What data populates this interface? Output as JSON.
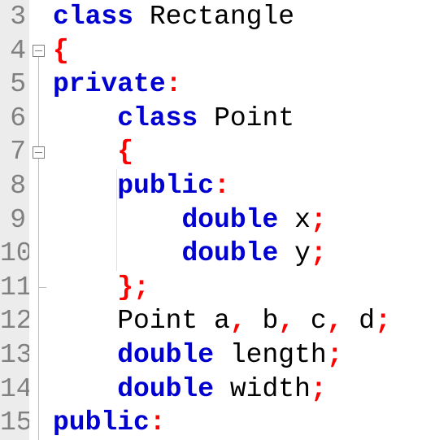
{
  "line_numbers": [
    "3",
    "4",
    "5",
    "6",
    "7",
    "8",
    "9",
    "10",
    "11",
    "12",
    "13",
    "14",
    "15"
  ],
  "code": {
    "l0": {
      "kw": "class",
      "sp": " ",
      "name": "Rectangle"
    },
    "l1": {
      "brace": "{"
    },
    "l2": {
      "access": "private",
      "colon": ":"
    },
    "l3": {
      "pad": "    ",
      "kw": "class",
      "sp": " ",
      "name": "Point"
    },
    "l4": {
      "pad": "    ",
      "brace": "{"
    },
    "l5": {
      "pad": "    ",
      "access": "public",
      "colon": ":"
    },
    "l6": {
      "pad": "        ",
      "kw": "double",
      "sp": " ",
      "name": "x",
      "semi": ";"
    },
    "l7": {
      "pad": "        ",
      "kw": "double",
      "sp": " ",
      "name": "y",
      "semi": ";"
    },
    "l8": {
      "pad": "    ",
      "brace": "}",
      "semi": ";"
    },
    "l9": {
      "pad": "    ",
      "t": "Point a",
      "c1": ",",
      "s1": " b",
      "c2": ",",
      "s2": " c",
      "c3": ",",
      "s3": " d",
      "semi": ";"
    },
    "l10": {
      "pad": "    ",
      "kw": "double",
      "sp": " ",
      "name": "length",
      "semi": ";"
    },
    "l11": {
      "pad": "    ",
      "kw": "double",
      "sp": " ",
      "name": "width",
      "semi": ";"
    },
    "l12": {
      "access": "public",
      "colon": ":"
    }
  },
  "chart_data": {
    "type": "table",
    "title": "C++ class definition in code editor",
    "lines": [
      {
        "n": 3,
        "text": "class Rectangle"
      },
      {
        "n": 4,
        "text": "{"
      },
      {
        "n": 5,
        "text": "private:"
      },
      {
        "n": 6,
        "text": "    class Point"
      },
      {
        "n": 7,
        "text": "    {"
      },
      {
        "n": 8,
        "text": "    public:"
      },
      {
        "n": 9,
        "text": "        double x;"
      },
      {
        "n": 10,
        "text": "        double y;"
      },
      {
        "n": 11,
        "text": "    };"
      },
      {
        "n": 12,
        "text": "    Point a, b, c, d;"
      },
      {
        "n": 13,
        "text": "    double length;"
      },
      {
        "n": 14,
        "text": "    double width;"
      },
      {
        "n": 15,
        "text": "public:"
      }
    ]
  }
}
